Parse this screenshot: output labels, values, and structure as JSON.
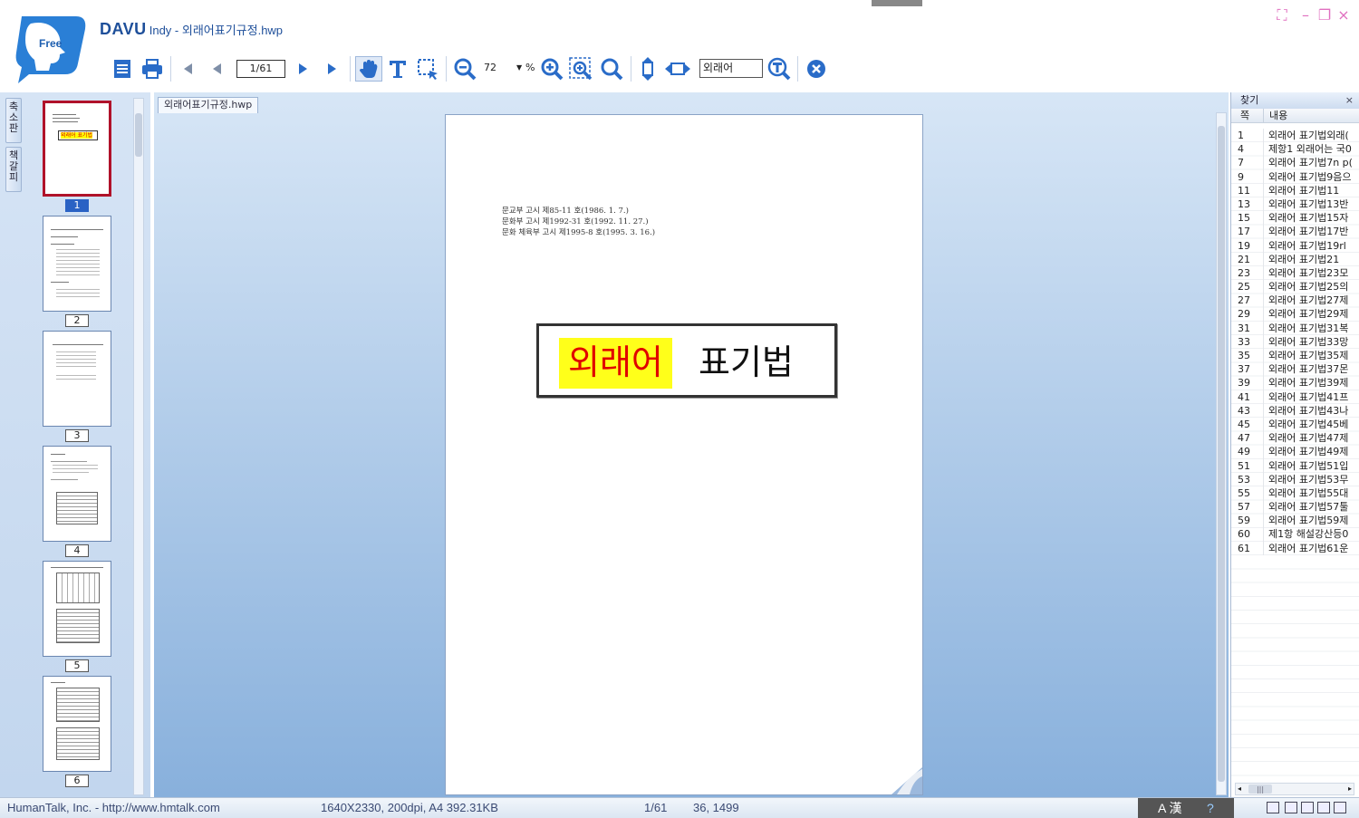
{
  "window": {
    "brand": "DAVU",
    "title_rest": "Indy - 외래어표기규정.hwp",
    "logo_text": "Free"
  },
  "toolbar": {
    "page_indicator": "1/61",
    "zoom_value": "72",
    "zoom_unit": "%",
    "search_text": "외래어"
  },
  "side_tabs": [
    "축소판",
    "책갈피"
  ],
  "thumbnails": [
    {
      "num": "1",
      "label": "외래어 표기법"
    },
    {
      "num": "2"
    },
    {
      "num": "3"
    },
    {
      "num": "4"
    },
    {
      "num": "5"
    },
    {
      "num": "6"
    }
  ],
  "document": {
    "tab_label": "외래어표기규정.hwp",
    "notices": [
      "문교부 고시 제85-11 호(1986. 1. 7.)",
      "문화부 고시 제1992-31 호(1992. 11. 27.)",
      "문화 체육부 고시 제1995-8 호(1995. 3. 16.)"
    ],
    "title_highlight": "외래어",
    "title_rest": "표기법"
  },
  "search_panel": {
    "title": "찾기",
    "close": "×",
    "col_page": "쪽",
    "col_content": "내용",
    "results": [
      {
        "page": "1",
        "text": "외래어 표기법외래("
      },
      {
        "page": "4",
        "text": "제항1 외래어는 국0"
      },
      {
        "page": "7",
        "text": "외래어 표기법7n p("
      },
      {
        "page": "9",
        "text": "외래어 표기법9음으"
      },
      {
        "page": "11",
        "text": "외래어 표기법11"
      },
      {
        "page": "13",
        "text": "외래어 표기법13반"
      },
      {
        "page": "15",
        "text": "외래어 표기법15자"
      },
      {
        "page": "17",
        "text": "외래어 표기법17반"
      },
      {
        "page": "19",
        "text": "외래어 표기법19rl"
      },
      {
        "page": "21",
        "text": "외래어 표기법21"
      },
      {
        "page": "23",
        "text": "외래어 표기법23모"
      },
      {
        "page": "25",
        "text": "외래어 표기법25의"
      },
      {
        "page": "27",
        "text": "외래어 표기법27제"
      },
      {
        "page": "29",
        "text": "외래어 표기법29제"
      },
      {
        "page": "31",
        "text": "외래어 표기법31복"
      },
      {
        "page": "33",
        "text": "외래어 표기법33망"
      },
      {
        "page": "35",
        "text": "외래어 표기법35제"
      },
      {
        "page": "37",
        "text": "외래어 표기법37몬"
      },
      {
        "page": "39",
        "text": "외래어 표기법39제"
      },
      {
        "page": "41",
        "text": "외래어 표기법41프"
      },
      {
        "page": "43",
        "text": "외래어 표기법43나"
      },
      {
        "page": "45",
        "text": "외래어 표기법45베"
      },
      {
        "page": "47",
        "text": "외래어 표기법47제"
      },
      {
        "page": "49",
        "text": "외래어 표기법49제"
      },
      {
        "page": "51",
        "text": "외래어 표기법51입"
      },
      {
        "page": "53",
        "text": "외래어 표기법53무"
      },
      {
        "page": "55",
        "text": "외래어 표기법55대"
      },
      {
        "page": "57",
        "text": "외래어 표기법57툴"
      },
      {
        "page": "59",
        "text": "외래어 표기법59제"
      },
      {
        "page": "60",
        "text": "제1항 해설강산등0"
      },
      {
        "page": "61",
        "text": "외래어 표기법61운"
      }
    ]
  },
  "statusbar": {
    "company": "HumanTalk, Inc. - http://www.hmtalk.com",
    "image_info": "1640X2330, 200dpi, A4  392.31KB",
    "page": "1/61",
    "coords": "36, 1499",
    "ime": "A 漢"
  },
  "colors": {
    "brand_blue": "#1e4f9a",
    "tool_blue": "#2a6cc8",
    "highlight_yellow": "#ffff1a",
    "title_red": "#e00000"
  }
}
